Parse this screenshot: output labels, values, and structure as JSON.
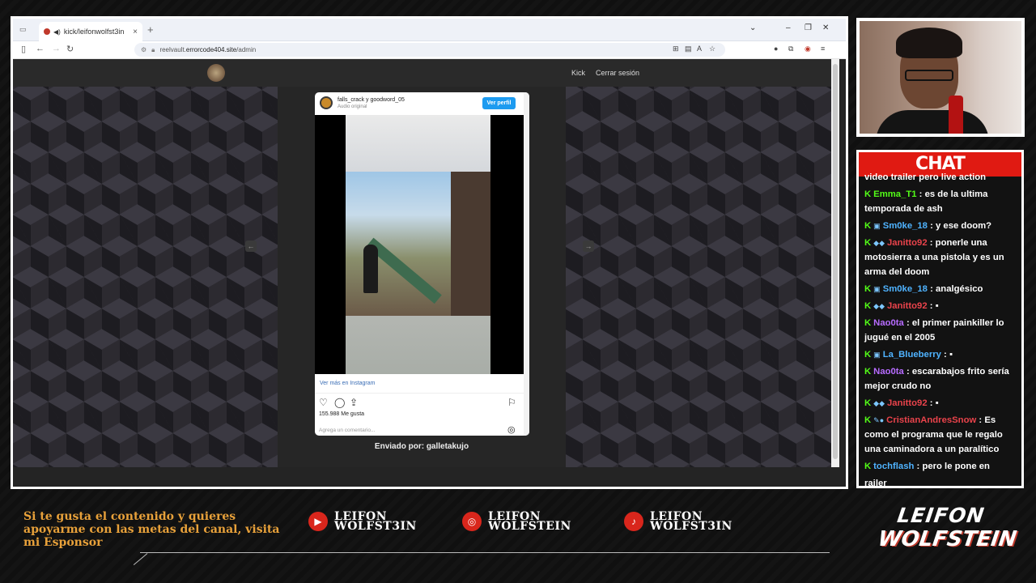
{
  "browser": {
    "tab_title": "kick/leifonwolfst3in",
    "url_prefix": "reelvault.",
    "url_domain": "errorcode404.site",
    "url_path": "/admin",
    "newtab_icon": "+",
    "tab_close": "×"
  },
  "site": {
    "nav_links": [
      "Kick",
      "Cerrar sesión"
    ]
  },
  "instagram": {
    "username": "falls_crack y goodword_05",
    "audio": "Audio original",
    "profile_button": "Ver perfil",
    "more_link": "Ver más en Instagram",
    "likes": "155.988 Me gusta",
    "comment_placeholder": "Agrega un comentario..."
  },
  "sent_by": "Enviado por: galletakujo",
  "chat": {
    "title": "CHAT",
    "partial_top": "video trailer pero live action",
    "messages": [
      {
        "user": "Emma_T1",
        "color": "#53fc18",
        "badges": "",
        "text": "es de la ultima temporada de ash"
      },
      {
        "user": "Sm0ke_18",
        "color": "#4fb3ff",
        "badges": "▣",
        "text": "y ese doom?"
      },
      {
        "user": "Janitto92",
        "color": "#e9434b",
        "badges": "◆◆",
        "text": "ponerle una motosierra a una pistola y es un arma del doom"
      },
      {
        "user": "Sm0ke_18",
        "color": "#4fb3ff",
        "badges": "▣",
        "text": "analgésico"
      },
      {
        "user": "Janitto92",
        "color": "#e9434b",
        "badges": "◆◆",
        "text": "▪"
      },
      {
        "user": "Nao0ta",
        "color": "#b76cff",
        "badges": "",
        "text": "el primer painkiller lo jugué en el 2005"
      },
      {
        "user": "La_Blueberry",
        "color": "#4fb3ff",
        "badges": "▣",
        "text": "▪"
      },
      {
        "user": "Nao0ta",
        "color": "#b76cff",
        "badges": "",
        "text": "escarabajos frito sería mejor crudo no"
      },
      {
        "user": "Janitto92",
        "color": "#e9434b",
        "badges": "◆◆",
        "text": "▪"
      },
      {
        "user": "CristianAndresSnow",
        "color": "#e9434b",
        "badges": "✎●",
        "text": "Es como el programa que le regalo una caminadora a un paralítico"
      },
      {
        "user": "tochflash",
        "color": "#4fb3ff",
        "badges": "",
        "text": "pero le pone en"
      }
    ],
    "partial_bottom": "railer"
  },
  "overlay": {
    "sponsor_text": "Si te gusta el contenido y quieres apoyarme con las metas del canal, visita mi Esponsor",
    "socials": [
      {
        "icon": "youtube-icon",
        "line1": "LEIFON",
        "line2": "WOLFST3IN"
      },
      {
        "icon": "instagram-icon",
        "line1": "LEIFON",
        "line2": "WOLFSTEIN"
      },
      {
        "icon": "tiktok-icon",
        "line1": "LEIFON",
        "line2": "WOLFST3IN"
      }
    ],
    "brand_line1": "LEIFON",
    "brand_line2": "WOLFSTEIN"
  },
  "colors": {
    "accent_red": "#e01a12",
    "kick_green": "#53fc18",
    "sponsor_gold": "#e8a13a",
    "instagram_blue": "#1d9bf0"
  }
}
